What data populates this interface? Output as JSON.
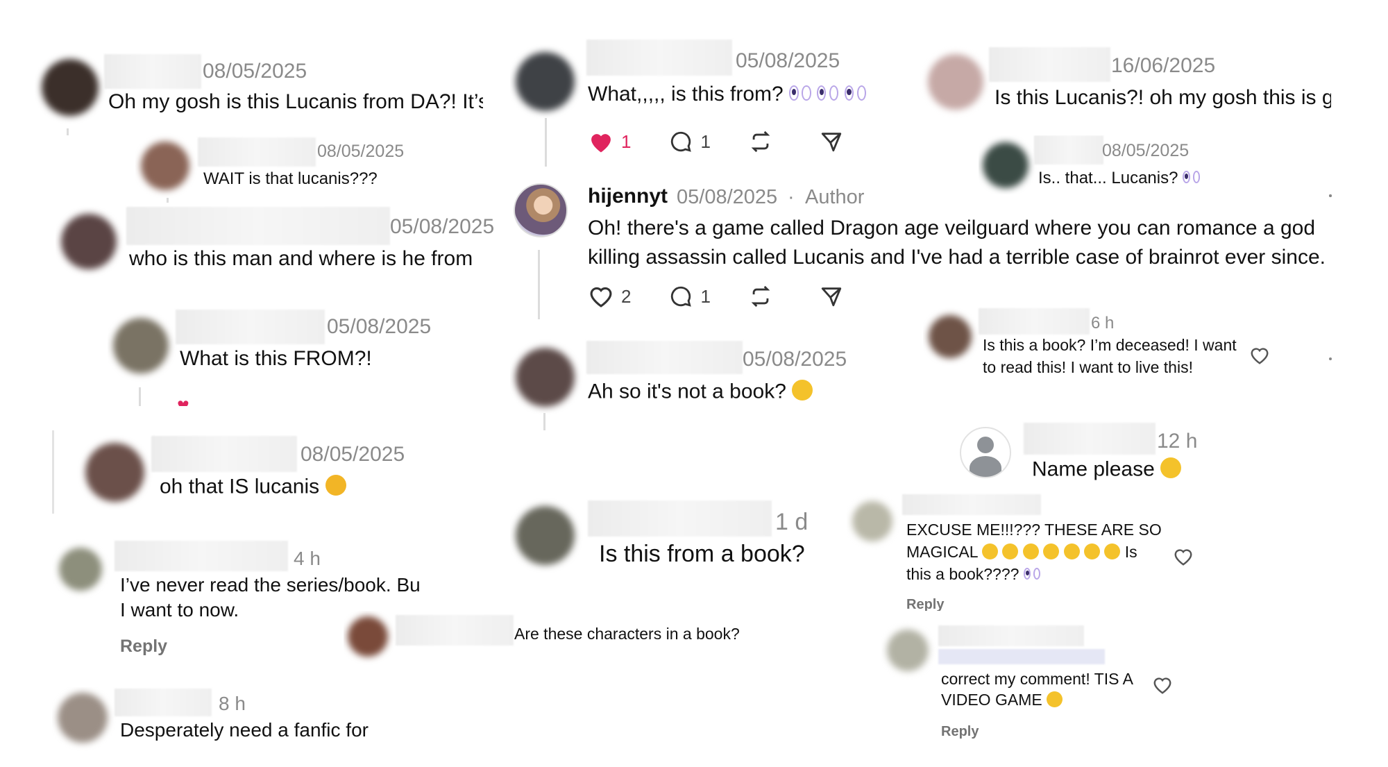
{
  "colors": {
    "like_red": "#e0245e",
    "timestamp_grey": "#8a8a8a",
    "divider": "#dcdcdc"
  },
  "comments": {
    "c1": {
      "date": "08/05/2025",
      "text": "Oh my gosh is this Lucanis from DA?! It’s ⁠S"
    },
    "c2": {
      "date": "08/05/2025",
      "text": "WAIT is that lucanis???"
    },
    "c3": {
      "date": "05/08/2025",
      "text": "who is this man and where is he from"
    },
    "c4": {
      "date": "05/08/2025",
      "text": "What is this FROM?!"
    },
    "c5": {
      "date": "08/05/2025",
      "text": "oh that IS lucanis"
    },
    "c6": {
      "time": "4 h",
      "line1": "I’ve never read the series/book. Bu",
      "line2": "I want to now.",
      "reply": "Reply"
    },
    "c7": {
      "time": "8 h",
      "text": "Desperately need a fanfic for"
    },
    "c8": {
      "date": "05/08/2025",
      "text": "What,,,,, is this from?",
      "likes": "1",
      "comments": "1"
    },
    "author": {
      "name": "hijennyt",
      "date": "05/08/2025",
      "sep": "·",
      "badge": "Author",
      "line1": "Oh! there's a game called Dragon age veilguard where you can romance a god",
      "line2": "killing assassin called Lucanis and I've had a terrible case of brainrot ever since.",
      "likes": "2",
      "comments": "1"
    },
    "c9": {
      "date": "05/08/2025",
      "text": "Ah so it's not a book?"
    },
    "c10": {
      "time": "1 d",
      "text": "Is this from a book?"
    },
    "c11": {
      "text": "Are these characters in a book?"
    },
    "c12": {
      "date": "16/06/2025",
      "text": "Is this Lucanis?! oh my gosh this is gc"
    },
    "c13": {
      "date": "08/05/2025",
      "text": "Is.. that... Lucanis?"
    },
    "c14": {
      "time": "6 h",
      "line1": "Is this a book? I’m deceased! I want",
      "line2": "to read this! I want to live this!"
    },
    "c15": {
      "time": "12 h",
      "text": "Name please"
    },
    "c16": {
      "line1": "EXCUSE ME!!!??? THESE ARE SO",
      "line2a": "MAGICAL",
      "line2b": "Is",
      "line3": "this a book????",
      "reply": "Reply"
    },
    "c17": {
      "line1": "correct my comment! TIS A",
      "line2": "VIDEO GAME",
      "reply": "Reply"
    }
  },
  "icons": [
    "heart-icon",
    "comment-icon",
    "repost-icon",
    "share-icon",
    "default-avatar-icon"
  ]
}
